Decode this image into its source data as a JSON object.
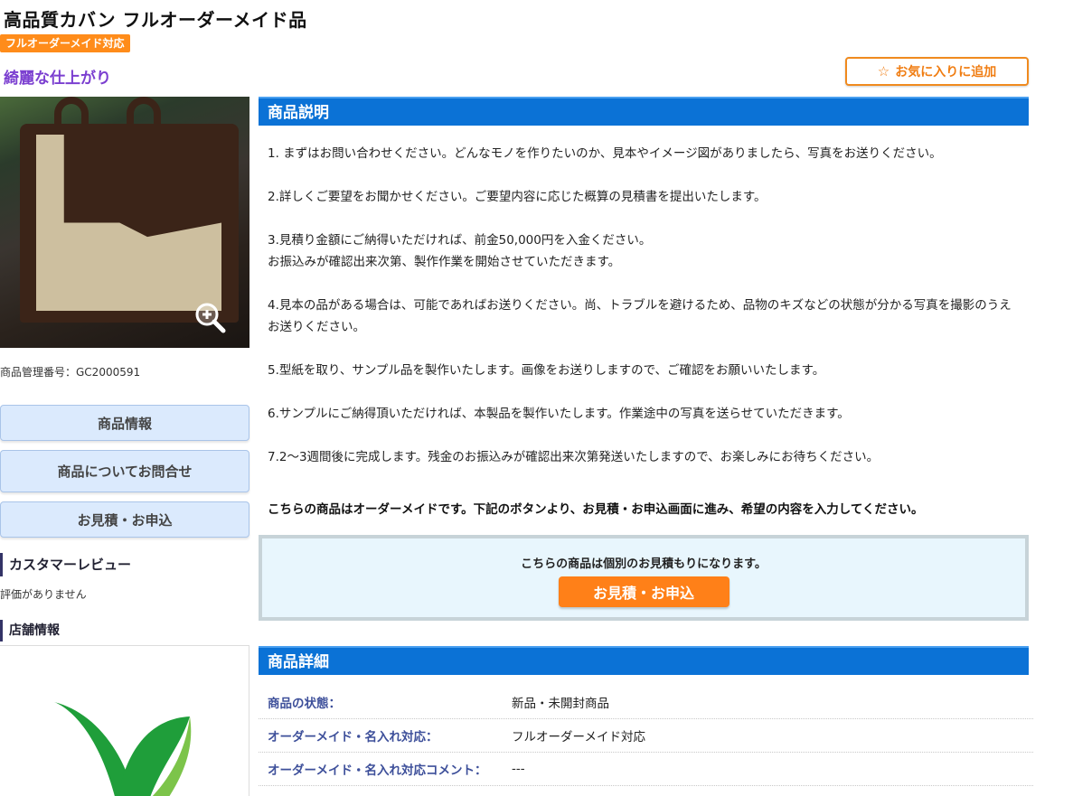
{
  "product": {
    "title": "高品質カバン フルオーダーメイド品",
    "badge": "フルオーダーメイド対応",
    "catchphrase": "綺麗な仕上がり",
    "sku_label": "商品管理番号：GC2000591"
  },
  "favorite_button": {
    "star": "☆",
    "label": "お気に入りに追加"
  },
  "sidebar": {
    "buttons": [
      {
        "label": "商品情報"
      },
      {
        "label": "商品についてお問合せ"
      },
      {
        "label": "お見積・お申込"
      }
    ],
    "review_heading": "カスタマーレビュー",
    "review_text": "評価がありません",
    "shop_heading": "店舗情報"
  },
  "description": {
    "heading": "商品説明",
    "steps": [
      "1. まずはお問い合わせください。どんなモノを作りたいのか、見本やイメージ図がありましたら、写真をお送りください。",
      "2.詳しくご要望をお聞かせください。ご要望内容に応じた概算の見積書を提出いたします。",
      "3.見積り金額にご納得いただければ、前金50,000円を入金ください。\nお振込みが確認出来次第、製作作業を開始させていただきます。",
      "4.見本の品がある場合は、可能であればお送りください。尚、トラブルを避けるため、品物のキズなどの状態が分かる写真を撮影のうえお送りください。",
      "5.型紙を取り、サンプル品を製作いたします。画像をお送りしますので、ご確認をお願いいたします。",
      "6.サンプルにご納得頂いただければ、本製品を製作いたします。作業途中の写真を送らせていただきます。",
      "7.2〜3週間後に完成します。残金のお振込みが確認出来次第発送いたしますので、お楽しみにお待ちください。"
    ],
    "notice": "こちらの商品はオーダーメイドです。下記のボタンより、お見積・お申込画面に進み、希望の内容を入力してください。"
  },
  "quote": {
    "text": "こちらの商品は個別のお見積もりになります。",
    "button": "お見積・お申込"
  },
  "details": {
    "heading": "商品詳細",
    "rows": [
      {
        "label": "商品の状態：",
        "value": "新品・未開封商品"
      },
      {
        "label": "オーダーメイド・名入れ対応：",
        "value": "フルオーダーメイド対応"
      },
      {
        "label": "オーダーメイド・名入れ対応コメント：",
        "value": "---"
      }
    ]
  },
  "colors": {
    "accent_orange": "#ff8018",
    "header_blue": "#0b72d6",
    "catch_purple": "#7b3fd0"
  }
}
